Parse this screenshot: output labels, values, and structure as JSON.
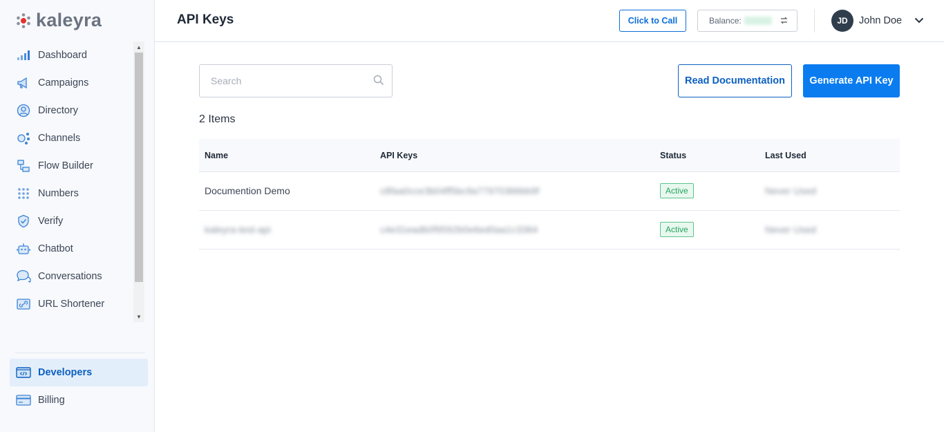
{
  "brand": {
    "logo_text": "kaleyra"
  },
  "sidebar": {
    "items": [
      {
        "label": "Dashboard",
        "icon": "bar-chart-icon"
      },
      {
        "label": "Campaigns",
        "icon": "megaphone-icon"
      },
      {
        "label": "Directory",
        "icon": "contact-icon"
      },
      {
        "label": "Channels",
        "icon": "channels-icon"
      },
      {
        "label": "Flow Builder",
        "icon": "flow-icon"
      },
      {
        "label": "Numbers",
        "icon": "dialpad-icon"
      },
      {
        "label": "Verify",
        "icon": "shield-icon"
      },
      {
        "label": "Chatbot",
        "icon": "robot-icon"
      },
      {
        "label": "Conversations",
        "icon": "chat-bubbles-icon"
      },
      {
        "label": "URL Shortener",
        "icon": "link-icon"
      }
    ],
    "bottom": [
      {
        "label": "Developers",
        "icon": "code-icon",
        "active": true
      },
      {
        "label": "Billing",
        "icon": "credit-card-icon",
        "active": false
      }
    ]
  },
  "header": {
    "title": "API Keys",
    "click_to_call": "Click to Call",
    "balance_label": "Balance:",
    "user_initials": "JD",
    "user_name": "John Doe"
  },
  "main": {
    "search_placeholder": "Search",
    "read_docs": "Read Documentation",
    "generate": "Generate API Key",
    "item_count": "2 Items",
    "columns": [
      "Name",
      "API Keys",
      "Status",
      "Last Used"
    ],
    "rows": [
      {
        "name": "Documention Demo",
        "name_blurred": false,
        "api_key": "c8faa0cce3b04ff5bc9a77970366bb9f",
        "status": "Active",
        "last_used": "Never Used"
      },
      {
        "name": "kaleyra-test-api",
        "name_blurred": true,
        "api_key": "c4e31eadb0f9592b0e6ed0aa1c3384",
        "status": "Active",
        "last_used": "Never Used"
      }
    ]
  },
  "colors": {
    "accent": "#0a7cf0",
    "active_badge": "#25a35f",
    "avatar": "#2f3d4c"
  }
}
